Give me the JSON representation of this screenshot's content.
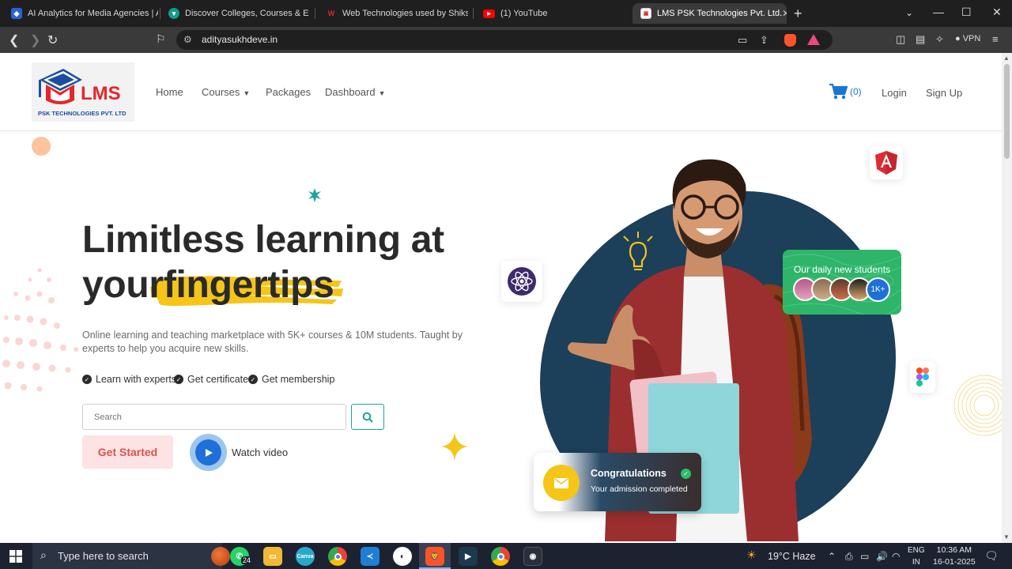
{
  "browser": {
    "tabs": [
      {
        "title": "AI Analytics for Media Agencies | AI",
        "active": false
      },
      {
        "title": "Discover Colleges, Courses & Exams",
        "active": false
      },
      {
        "title": "Web Technologies used by Shiksha",
        "active": false
      },
      {
        "title": "(1) YouTube",
        "active": false
      },
      {
        "title": "LMS PSK Technologies Pvt. Ltd.",
        "active": true
      }
    ],
    "url": "adityasukhdeve.in",
    "vpn_label": "VPN"
  },
  "header": {
    "logo_text": "LMS",
    "logo_subtitle": "PSK TECHNOLOGIES PVT. LTD",
    "menu": [
      {
        "label": "Home",
        "has_dropdown": false
      },
      {
        "label": "Courses",
        "has_dropdown": true
      },
      {
        "label": "Packages",
        "has_dropdown": false
      },
      {
        "label": "Dashboard",
        "has_dropdown": true
      }
    ],
    "cart_count": "(0)",
    "login": "Login",
    "signup": "Sign Up"
  },
  "hero": {
    "title_line1": "Limitless learning at",
    "title_line2_plain": "your",
    "title_line2_highlight": "fingertips",
    "description": "Online learning and teaching marketplace with 5K+ courses & 10M students. Taught by experts to help you acquire new skills.",
    "features": [
      "Learn with experts",
      "Get certificate",
      "Get membership"
    ],
    "search_placeholder": "Search",
    "cta_label": "Get Started",
    "watch_label": "Watch video"
  },
  "daily_card": {
    "title": "Our daily new students",
    "more_label": "1K+"
  },
  "congrats_card": {
    "title": "Congratulations",
    "subtitle": "Your admission completed"
  },
  "taskbar": {
    "search_placeholder": "Type here to search",
    "whatsapp_badge": "24",
    "weather": "19°C  Haze",
    "lang_line1": "ENG",
    "lang_line2": "IN",
    "time": "10:36 AM",
    "date": "16-01-2025"
  },
  "colors": {
    "accent_red": "#e4262b",
    "accent_teal": "#1ca59a",
    "highlight_yellow": "#f5c518",
    "blob_navy": "#1c3f5a",
    "green_card": "#2fb56a"
  }
}
